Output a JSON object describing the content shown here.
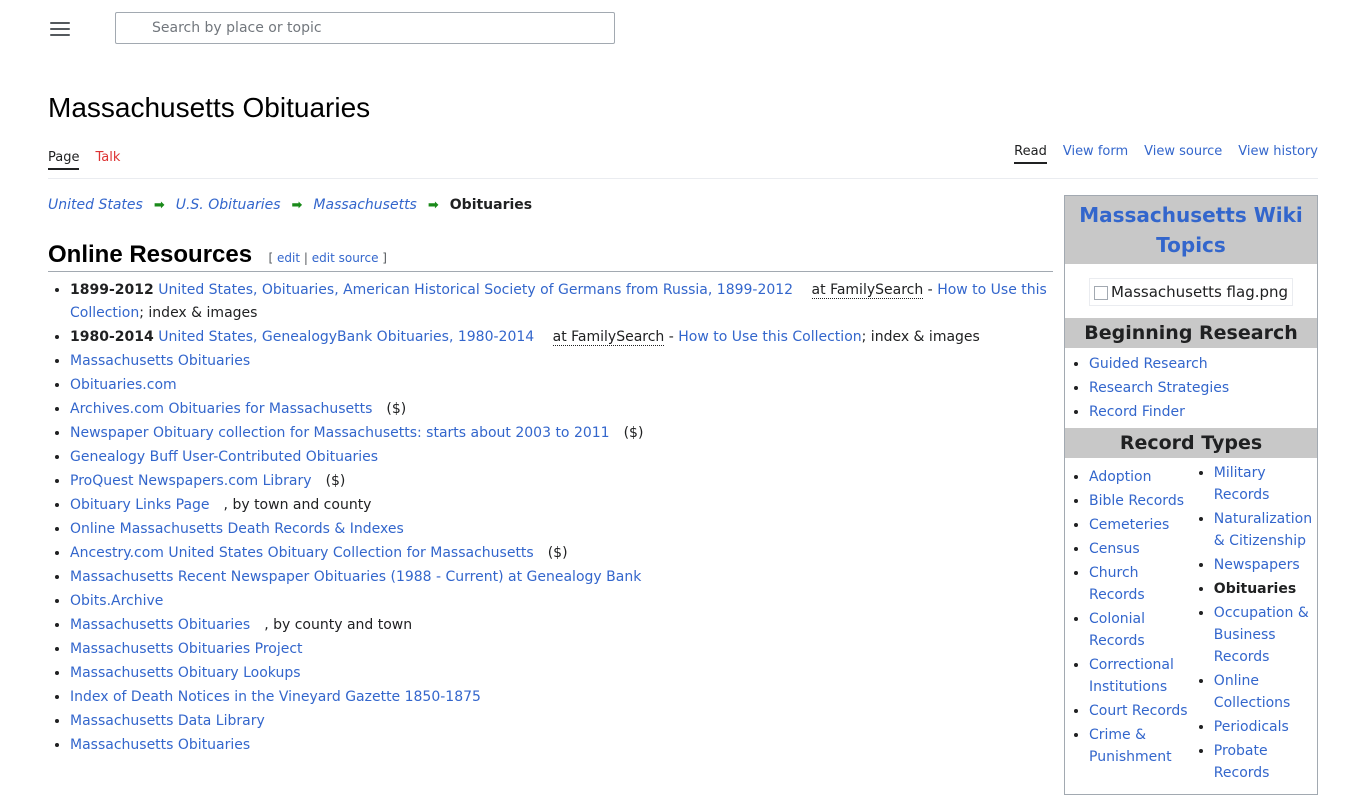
{
  "header": {
    "search_placeholder": "Search by place or topic"
  },
  "page": {
    "title": "Massachusetts Obituaries"
  },
  "tabs": {
    "page": "Page",
    "talk": "Talk",
    "read": "Read",
    "view_form": "View form",
    "view_source": "View source",
    "view_history": "View history"
  },
  "breadcrumb": {
    "items": [
      "United States",
      "U.S. Obituaries",
      "Massachusetts"
    ],
    "current": "Obituaries"
  },
  "section": {
    "heading": "Online Resources",
    "edit_links": [
      "edit",
      "edit source"
    ]
  },
  "resources": {
    "r1": {
      "years": "1899-2012",
      "link": "United States, Obituaries, American Historical Society of Germans from Russia, 1899-2012",
      "at": "at FamilySearch",
      "dash": "-",
      "howto": "How to Use this Collection",
      "suffix": "; index & images"
    },
    "r2": {
      "years": "1980-2014",
      "link": "United States, GenealogyBank Obituaries, 1980-2014",
      "at": "at FamilySearch",
      "dash": "-",
      "howto": "How to Use this Collection",
      "suffix": "; index & images"
    },
    "r3": {
      "link": "Massachusetts Obituaries"
    },
    "r4": {
      "link": "Obituaries.com"
    },
    "r5": {
      "link": "Archives.com Obituaries for Massachusetts",
      "note": "($)"
    },
    "r6": {
      "link": "Newspaper Obituary collection for Massachusetts: starts about 2003 to 2011",
      "note": "($)"
    },
    "r7": {
      "link": "Genealogy Buff User-Contributed Obituaries"
    },
    "r8": {
      "link": "ProQuest Newspapers.com Library",
      "note": "($)"
    },
    "r9": {
      "link": "Obituary Links Page",
      "note": ", by town and county"
    },
    "r10": {
      "link": "Online Massachusetts Death Records & Indexes"
    },
    "r11": {
      "link": "Ancestry.com United States Obituary Collection for Massachusetts",
      "note": "($)"
    },
    "r12": {
      "link": "Massachusetts Recent Newspaper Obituaries (1988 - Current) at Genealogy Bank"
    },
    "r13": {
      "link": "Obits.Archive"
    },
    "r14": {
      "link": "Massachusetts Obituaries",
      "note": ", by county and town"
    },
    "r15": {
      "link": "Massachusetts Obituaries Project"
    },
    "r16": {
      "link": "Massachusetts Obituary Lookups"
    },
    "r17": {
      "link": "Index of Death Notices in the Vineyard Gazette 1850-1875"
    },
    "r18": {
      "link": "Massachusetts Data Library"
    },
    "r19": {
      "link": "Massachusetts Obituaries"
    }
  },
  "sidebar": {
    "title": "Massachusetts Wiki Topics",
    "flag_alt": "Massachusetts flag.png",
    "beginning_heading": "Beginning Research",
    "beginning": [
      "Guided Research",
      "Research Strategies",
      "Record Finder"
    ],
    "record_types_heading": "Record Types",
    "col1": [
      "Adoption",
      "Bible Records",
      "Cemeteries",
      "Census",
      "Church Records",
      "Colonial Records",
      "Correctional Institutions",
      "Court Records",
      "Crime & Punishment"
    ],
    "col2": [
      "Military Records",
      "Naturalization & Citizenship",
      "Newspapers",
      "Obituaries",
      "Occupation & Business Records",
      "Online Collections",
      "Periodicals",
      "Probate Records"
    ]
  },
  "colors": {
    "link": "#3366cc",
    "talk": "#dd3333",
    "arrow": "#1a8a1a",
    "sidebar_header": "#c8c8c8"
  },
  "icons": [
    "menu-icon",
    "search-icon",
    "arrow-right-icon",
    "broken-image-icon"
  ]
}
